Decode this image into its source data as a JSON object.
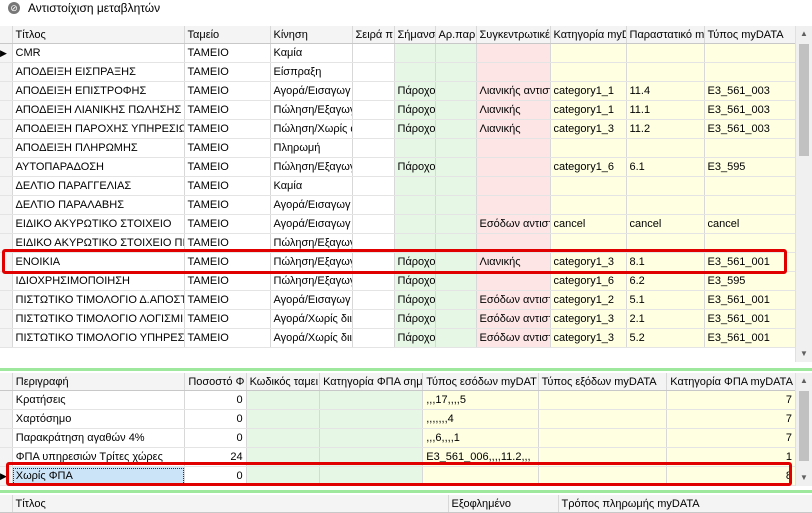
{
  "window": {
    "title": "Αντιστοίχιση μεταβλητών"
  },
  "top_grid": {
    "columns": [
      "Τίτλος",
      "Ταμείο",
      "Κίνηση",
      "Σειρά π",
      "Σήμανσ",
      "Αρ.παρ",
      "Συγκεντρωτικέ",
      "Κατηγορία myD",
      "Παραστατικό m",
      "Τύπος myDATA"
    ],
    "rows": [
      [
        "CMR",
        "ΤΑΜΕΙΟ",
        "Καμία",
        "",
        "",
        "",
        "",
        "",
        "",
        ""
      ],
      [
        "ΑΠΟΔΕΙΞΗ ΕΙΣΠΡΑΞΗΣ",
        "ΤΑΜΕΙΟ",
        "Είσπραξη",
        "",
        "",
        "",
        "",
        "",
        "",
        ""
      ],
      [
        "ΑΠΟΔΕΙΞΗ ΕΠΙΣΤΡΟΦΗΣ",
        "ΤΑΜΕΙΟ",
        "Αγορά/Εισαγωγ",
        "",
        "Πάροχο",
        "",
        "Λιανικής αντιστ",
        "category1_1",
        "11.4",
        "E3_561_003"
      ],
      [
        "ΑΠΟΔΕΙΞΗ ΛΙΑΝΙΚΗΣ ΠΩΛΗΣΗΣ",
        "ΤΑΜΕΙΟ",
        "Πώληση/Εξαγωγ",
        "",
        "Πάροχο",
        "",
        "Λιανικής",
        "category1_1",
        "11.1",
        "E3_561_003"
      ],
      [
        "ΑΠΟΔΕΙΞΗ ΠΑΡΟΧΗΣ ΥΠΗΡΕΣΙΩΝ",
        "ΤΑΜΕΙΟ",
        "Πώληση/Χωρίς ά",
        "",
        "Πάροχο",
        "",
        "Λιανικής",
        "category1_3",
        "11.2",
        "E3_561_003"
      ],
      [
        "ΑΠΟΔΕΙΞΗ ΠΛΗΡΩΜΗΣ",
        "ΤΑΜΕΙΟ",
        "Πληρωμή",
        "",
        "",
        "",
        "",
        "",
        "",
        ""
      ],
      [
        "ΑΥΤΟΠΑΡΑΔΟΣΗ",
        "ΤΑΜΕΙΟ",
        "Πώληση/Εξαγωγ",
        "",
        "Πάροχο",
        "",
        "",
        "category1_6",
        "6.1",
        "E3_595"
      ],
      [
        "ΔΕΛΤΙΟ ΠΑΡΑΓΓΕΛΙΑΣ",
        "ΤΑΜΕΙΟ",
        "Καμία",
        "",
        "",
        "",
        "",
        "",
        "",
        ""
      ],
      [
        "ΔΕΛΤΙΟ ΠΑΡΑΛΑΒΗΣ",
        "ΤΑΜΕΙΟ",
        "Αγορά/Εισαγωγ",
        "",
        "",
        "",
        "",
        "",
        "",
        ""
      ],
      [
        "ΕΙΔΙΚΟ ΑΚΥΡΩΤΙΚΟ ΣΤΟΙΧΕΙΟ",
        "ΤΑΜΕΙΟ",
        "Αγορά/Εισαγωγ",
        "",
        "",
        "",
        "Εσόδων αντιστ",
        "cancel",
        "cancel",
        "cancel"
      ],
      [
        "ΕΙΔΙΚΟ ΑΚΥΡΩΤΙΚΟ ΣΤΟΙΧΕΙΟ ΠΙΣΤ",
        "ΤΑΜΕΙΟ",
        "Πώληση/Εξαγωγ",
        "",
        "",
        "",
        "",
        "",
        "",
        ""
      ],
      [
        "ΕΝΟΙΚΙΑ",
        "ΤΑΜΕΙΟ",
        "Πώληση/Εξαγωγ",
        "",
        "Πάροχο",
        "",
        "Λιανικής",
        "category1_3",
        "8.1",
        "E3_561_001"
      ],
      [
        "ΙΔΙΟΧΡΗΣΙΜΟΠΟΙΗΣΗ",
        "ΤΑΜΕΙΟ",
        "Πώληση/Εξαγωγ",
        "",
        "Πάροχο",
        "",
        "",
        "category1_6",
        "6.2",
        "E3_595"
      ],
      [
        "ΠΙΣΤΩΤΙΚΟ ΤΙΜΟΛΟΓΙΟ Δ.ΑΠΟΣΤ",
        "ΤΑΜΕΙΟ",
        "Αγορά/Εισαγωγ",
        "",
        "Πάροχο",
        "",
        "Εσόδων αντιστ",
        "category1_2",
        "5.1",
        "E3_561_001"
      ],
      [
        "ΠΙΣΤΩΤΙΚΟ ΤΙΜΟΛΟΓΙΟ ΛΟΓΙΣΜΙΚ",
        "ΤΑΜΕΙΟ",
        "Αγορά/Χωρίς διι Α",
        "",
        "Πάροχο",
        "",
        "Εσόδων αντιστ",
        "category1_3",
        "2.1",
        "E3_561_001"
      ],
      [
        "ΠΙΣΤΩΤΙΚΟ ΤΙΜΟΛΟΓΙΟ ΥΠΗΡΕΣΙ",
        "ΤΑΜΕΙΟ",
        "Αγορά/Χωρίς διι Β",
        "",
        "Πάροχο",
        "",
        "Εσόδων αντιστ",
        "category1_3",
        "5.2",
        "E3_561_001"
      ]
    ]
  },
  "mid_grid": {
    "columns": [
      "Περιγραφή",
      "Ποσοστό Φ",
      "Κωδικός ταμει",
      "Κατηγορία ΦΠΑ σημ",
      "Τύπος εσόδων myDAT",
      "Τύπος εξόδων myDATA",
      "Κατηγορία ΦΠΑ myDATA"
    ],
    "rows": [
      [
        "Κρατήσεις",
        "0",
        "",
        "",
        ",,,17,,,,5",
        "",
        "7"
      ],
      [
        "Χαρτόσημο",
        "0",
        "",
        "",
        ",,,,,,,4",
        "",
        "7"
      ],
      [
        "Παρακράτηση αγαθών 4%",
        "0",
        "",
        "",
        ",,,6,,,,1",
        "",
        "7"
      ],
      [
        "ΦΠΑ  υπηρεσιών Τρίτες χώρες",
        "24",
        "",
        "",
        "E3_561_006,,,,11.2,,,",
        "",
        "1"
      ],
      [
        "Χωρίς ΦΠΑ",
        "0",
        "",
        "",
        "",
        "",
        "8"
      ]
    ]
  },
  "bottom_grid": {
    "columns": [
      "Τίτλος",
      "Εξοφλημένο",
      "Τρόπος πληρωμής myDATA"
    ]
  },
  "colors": {
    "highlight": "#e00000",
    "green": "#e6f7e6",
    "pink": "#fde5e5",
    "yellow": "#ffffe2",
    "splitter": "#9de89d"
  },
  "icons": [
    "window-icon",
    "current-row-indicator",
    "scroll-up-icon",
    "scroll-down-icon"
  ]
}
